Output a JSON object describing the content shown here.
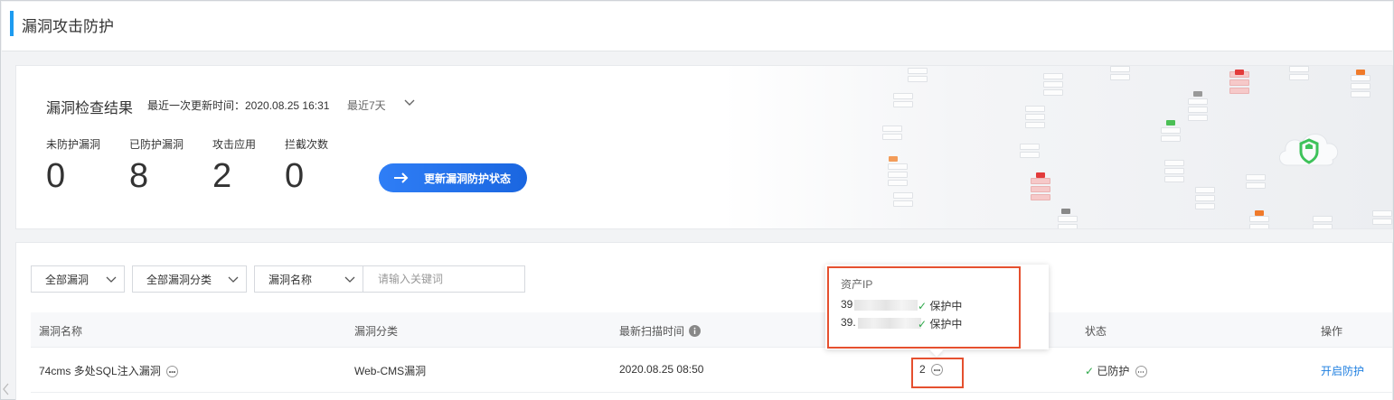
{
  "page": {
    "title": "漏洞攻击防护"
  },
  "summary": {
    "title": "漏洞检查结果",
    "updated": "最近一次更新时间：2020.08.25 16:31",
    "range": "最近7天",
    "metrics": [
      {
        "label": "未防护漏洞",
        "value": "0"
      },
      {
        "label": "已防护漏洞",
        "value": "8"
      },
      {
        "label": "攻击应用",
        "value": "2"
      },
      {
        "label": "拦截次数",
        "value": "0"
      }
    ],
    "refresh_label": "更新漏洞防护状态"
  },
  "filters": {
    "type": "全部漏洞",
    "category": "全部漏洞分类",
    "field": "漏洞名称",
    "search_placeholder": "请输入关键词"
  },
  "table": {
    "headers": [
      "漏洞名称",
      "漏洞分类",
      "最新扫描时间",
      "状态",
      "操作"
    ],
    "rows": [
      {
        "name": "74cms 多处SQL注入漏洞",
        "category": "Web-CMS漏洞",
        "scan_time": "2020.08.25 08:50",
        "assets": "2",
        "status": "已防护",
        "action": "开启防护"
      }
    ]
  },
  "popover": {
    "title": "资产IP",
    "items": [
      {
        "ip": "39",
        "status": "保护中"
      },
      {
        "ip": "39.",
        "status": "保护中"
      }
    ]
  },
  "colors": {
    "accent": "#1d9bf0",
    "button": "#2f7ef6",
    "success": "#2ea84a",
    "highlight": "#e5502f",
    "link": "#1f7fe0"
  }
}
